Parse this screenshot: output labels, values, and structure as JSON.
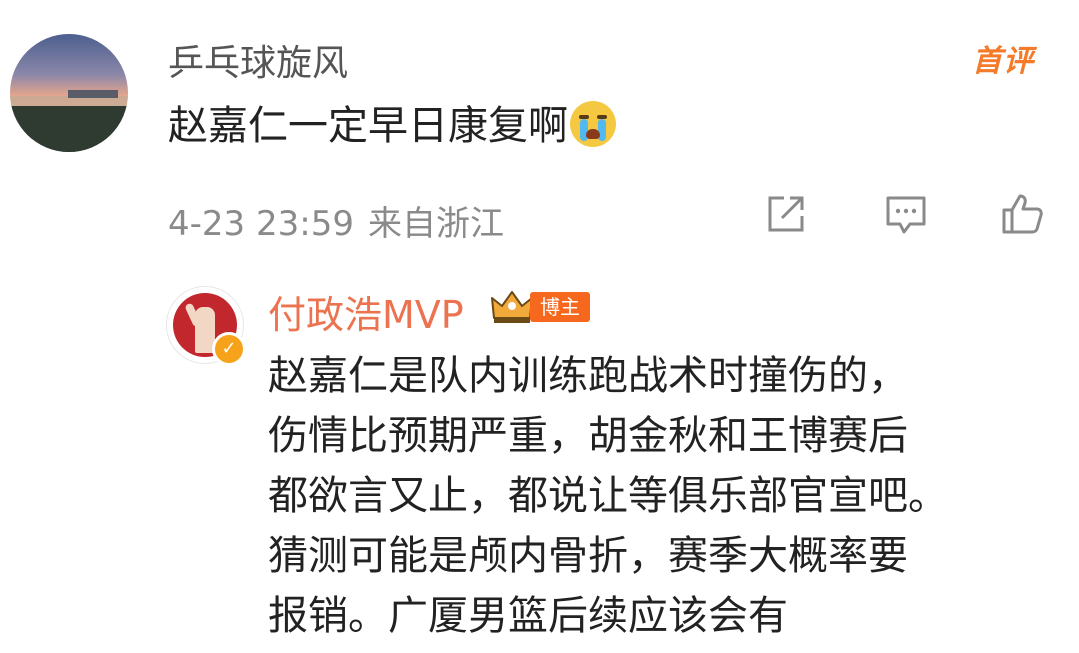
{
  "top_comment": {
    "username": "乒乓球旋风",
    "badge": "首评",
    "text": "赵嘉仁一定早日康复啊",
    "emoji": "crying-face-icon",
    "time": "4-23 23:59",
    "location": "来自浙江",
    "actions": [
      "share-icon",
      "comment-icon",
      "like-icon"
    ]
  },
  "reply": {
    "username": "付政浩MVP",
    "role_tag": "博主",
    "lines": [
      "赵嘉仁是队内训练跑战术时撞伤的，",
      "伤情比预期严重，胡金秋和王博赛后",
      "都欲言又止，都说让等俱乐部官宣吧。",
      "猜测可能是颅内骨折，赛季大概率要",
      "报销。广厦男篮后续应该会有"
    ]
  },
  "colors": {
    "username_gray": "#555555",
    "meta_gray": "#8a8a8a",
    "blogger_name": "#eb7350",
    "badge_orange": "#f47b2a",
    "tag_orange": "#f5681e"
  }
}
